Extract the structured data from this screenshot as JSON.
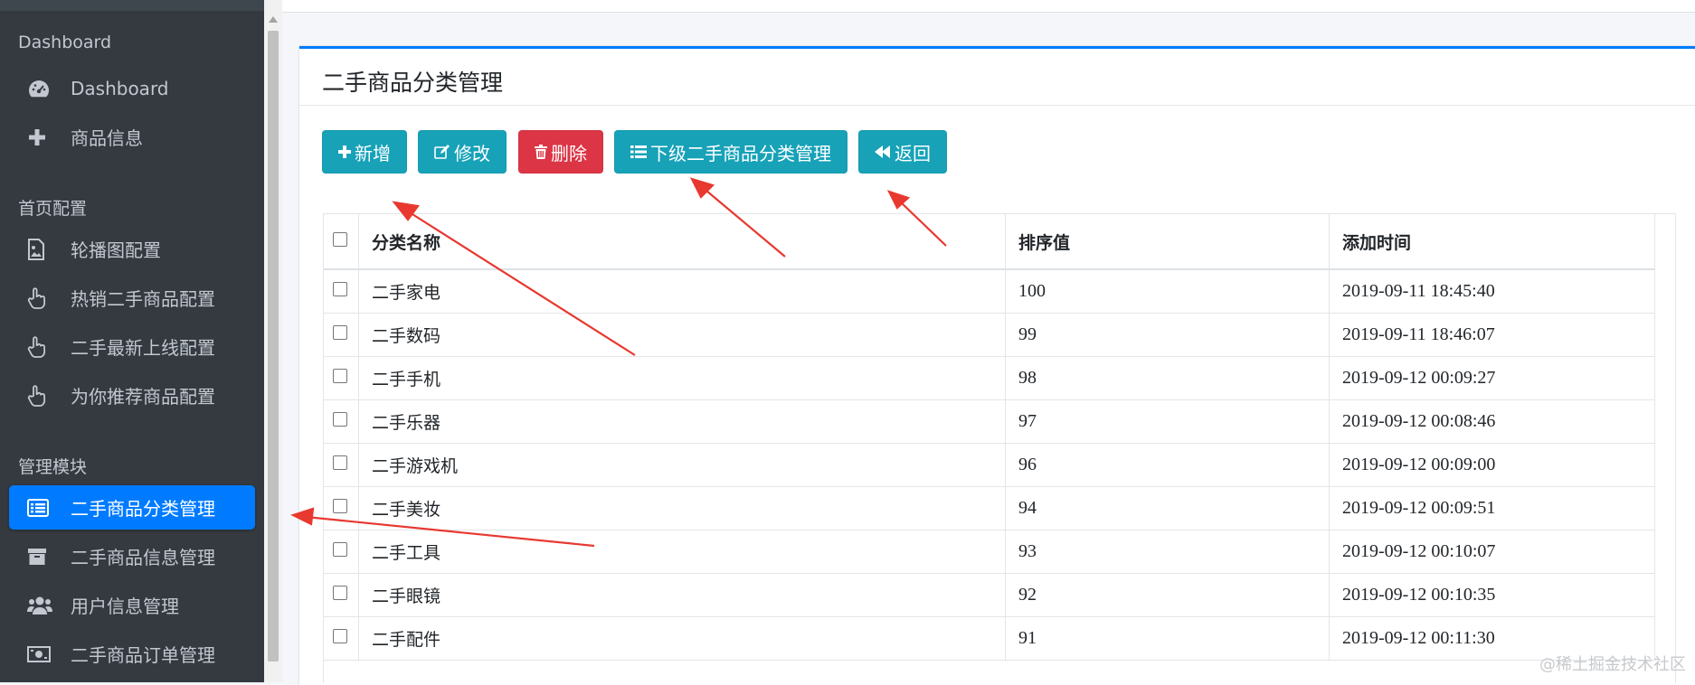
{
  "sidebar": {
    "sections": [
      {
        "header": "Dashboard"
      },
      {
        "header": "首页配置"
      },
      {
        "header": "管理模块"
      }
    ],
    "items": [
      {
        "label": "Dashboard",
        "icon": "dashboard-icon"
      },
      {
        "label": "商品信息",
        "icon": "plus-icon"
      },
      {
        "label": "轮播图配置",
        "icon": "image-file-icon"
      },
      {
        "label": "热销二手商品配置",
        "icon": "hand-pointer-icon"
      },
      {
        "label": "二手最新上线配置",
        "icon": "hand-pointer-icon"
      },
      {
        "label": "为你推荐商品配置",
        "icon": "hand-pointer-icon"
      },
      {
        "label": "二手商品分类管理",
        "icon": "list-alt-icon",
        "active": true
      },
      {
        "label": "二手商品信息管理",
        "icon": "archive-icon"
      },
      {
        "label": "用户信息管理",
        "icon": "users-icon"
      },
      {
        "label": "二手商品订单管理",
        "icon": "money-icon"
      }
    ]
  },
  "card": {
    "title": "二手商品分类管理"
  },
  "toolbar": {
    "add_label": "新增",
    "edit_label": "修改",
    "delete_label": "删除",
    "sub_label": "下级二手商品分类管理",
    "back_label": "返回"
  },
  "table": {
    "headers": [
      "分类名称",
      "排序值",
      "添加时间"
    ],
    "rows": [
      {
        "name": "二手家电",
        "rank": "100",
        "time": "2019-09-11 18:45:40"
      },
      {
        "name": "二手数码",
        "rank": "99",
        "time": "2019-09-11 18:46:07"
      },
      {
        "name": "二手手机",
        "rank": "98",
        "time": "2019-09-12 00:09:27"
      },
      {
        "name": "二手乐器",
        "rank": "97",
        "time": "2019-09-12 00:08:46"
      },
      {
        "name": "二手游戏机",
        "rank": "96",
        "time": "2019-09-12 00:09:00"
      },
      {
        "name": "二手美妆",
        "rank": "94",
        "time": "2019-09-12 00:09:51"
      },
      {
        "name": "二手工具",
        "rank": "93",
        "time": "2019-09-12 00:10:07"
      },
      {
        "name": "二手眼镜",
        "rank": "92",
        "time": "2019-09-12 00:10:35"
      },
      {
        "name": "二手配件",
        "rank": "91",
        "time": "2019-09-12 00:11:30"
      }
    ]
  },
  "watermark": "@稀土掘金技术社区",
  "colors": {
    "sidebar_bg": "#343a40",
    "active": "#007bff",
    "info": "#17a2b8",
    "danger": "#dc3545",
    "annotation_arrow": "#e8382f"
  }
}
